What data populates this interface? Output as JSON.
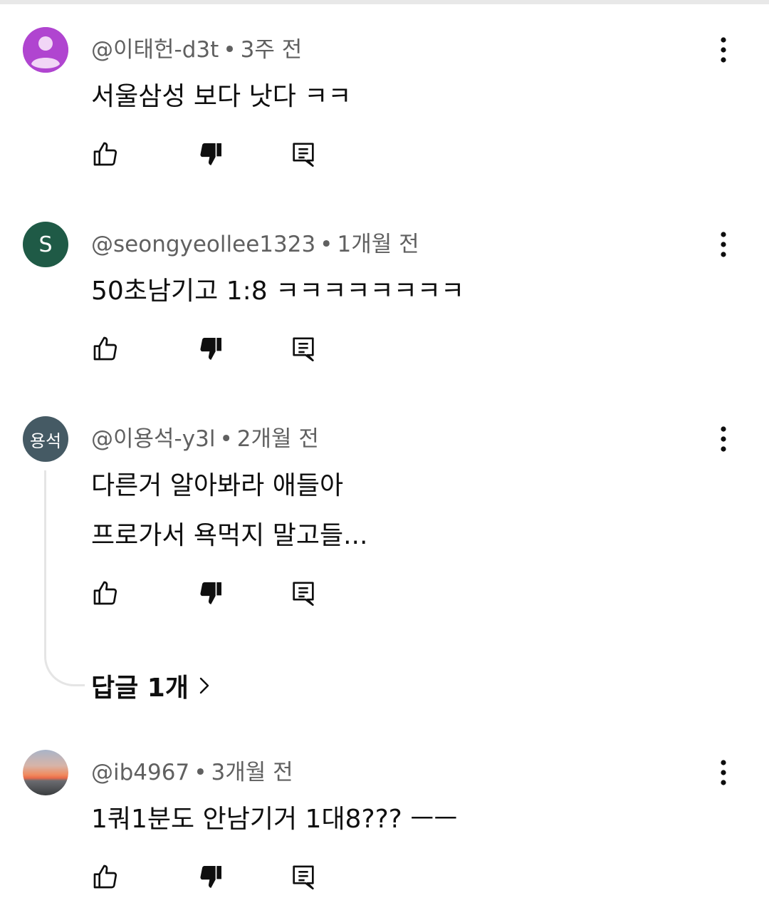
{
  "colors": {
    "avatar1_bg": "#b045d0",
    "avatar2_bg": "#1f5a46",
    "avatar3_bg": "#455a64",
    "meta_text": "#606060",
    "icon": "#0f0f0f"
  },
  "comments": [
    {
      "author": "@이태헌-d3t",
      "time": "3주 전",
      "text": [
        "서울삼성 보다  낫다 ㅋㅋ"
      ],
      "avatar": "default-person-icon"
    },
    {
      "author": "@seongyeollee1323",
      "time": "1개월 전",
      "text": [
        "50초남기고 1:8 ㅋㅋㅋㅋㅋㅋㅋㅋ"
      ],
      "avatar_letter": "S"
    },
    {
      "author": "@이용석-y3l",
      "time": "2개월 전",
      "text": [
        "다른거 알아봐라 애들아",
        "프로가서 욕먹지 말고들..."
      ],
      "avatar_letter": "용석",
      "replies_label": "답글 1개"
    },
    {
      "author": "@ib4967",
      "time": "3개월 전",
      "text": [
        "1쿼1분도  안남기거  1대8??? ㅡㅡ"
      ],
      "avatar": "sunset-photo"
    }
  ],
  "separator": "•",
  "icons": [
    "like-icon",
    "dislike-icon",
    "reply-icon",
    "more-vert-icon",
    "chevron-right-icon"
  ]
}
